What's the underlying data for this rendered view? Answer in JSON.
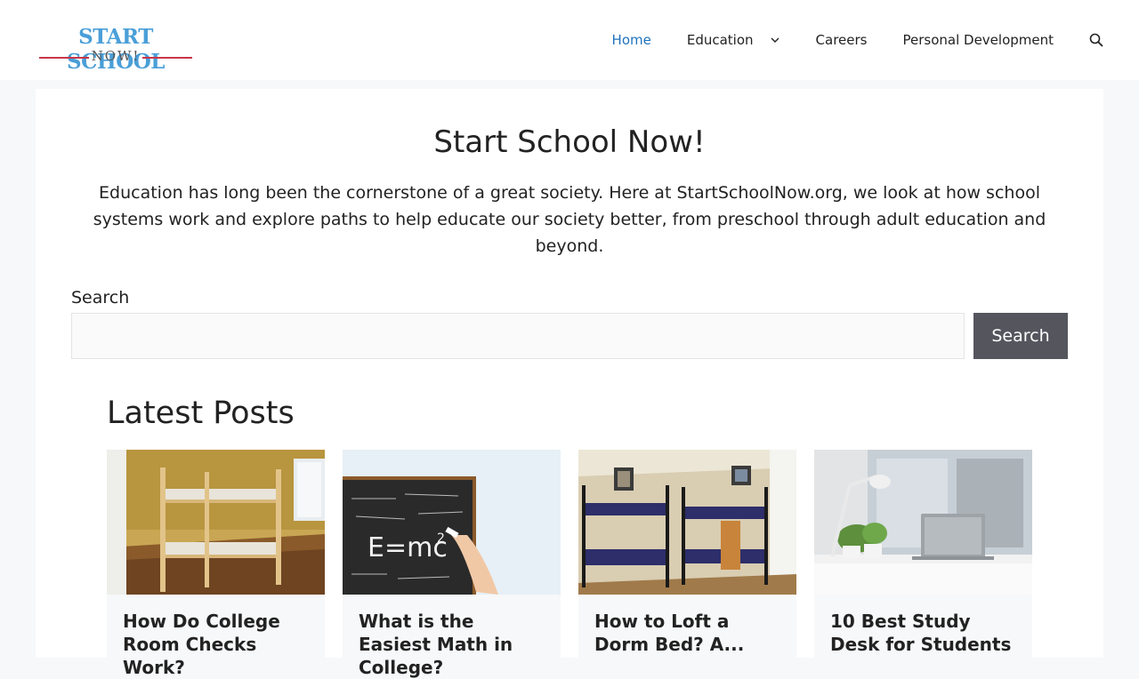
{
  "header": {
    "logo_main": "START SCHOOL",
    "logo_sub": "NOW!",
    "nav": [
      {
        "label": "Home",
        "active": true
      },
      {
        "label": "Education",
        "has_dropdown": true
      },
      {
        "label": "Careers"
      },
      {
        "label": "Personal Development"
      }
    ],
    "search_icon": "search-icon"
  },
  "main": {
    "title": "Start School Now!",
    "intro": "Education has long been the cornerstone of a great society. Here at StartSchoolNow.org, we look at how school systems work and explore paths to help educate our society better, from preschool through adult education and beyond.",
    "search": {
      "label": "Search",
      "placeholder": "",
      "value": "",
      "button": "Search"
    },
    "latest_title": "Latest Posts",
    "posts": [
      {
        "title": "How Do College Room Checks Work?",
        "image": "bunk-bed-room-photo"
      },
      {
        "title": "What is the Easiest Math in College?",
        "image": "chalkboard-emc2-photo"
      },
      {
        "title": "How to Loft a Dorm Bed? A...",
        "image": "dorm-bunk-beds-photo"
      },
      {
        "title": "10 Best Study Desk for Students",
        "image": "study-desk-laptop-photo"
      }
    ]
  },
  "colors": {
    "accent": "#1e73be",
    "logo_blue": "#4a9fd8",
    "logo_red": "#c8354a",
    "button_bg": "#55555e",
    "page_bg": "#f7f8f9"
  }
}
